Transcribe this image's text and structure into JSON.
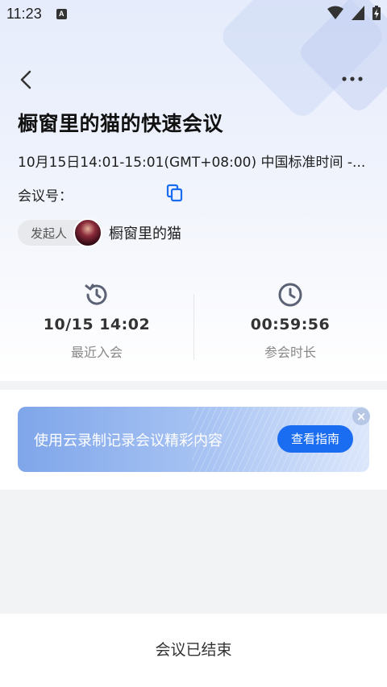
{
  "status_bar": {
    "time": "11:23",
    "notification_icon": "A"
  },
  "header": {
    "title": "橱窗里的猫的快速会议",
    "time_range": "10月15日14:01-15:01(GMT+08:00) 中国标准时间 -...",
    "meeting_id_label": "会议号：",
    "host_label": "发起人",
    "host_name": "橱窗里的猫"
  },
  "stats": [
    {
      "icon": "history-icon",
      "value": "10/15 14:02",
      "label": "最近入会"
    },
    {
      "icon": "clock-icon",
      "value": "00:59:56",
      "label": "参会时长"
    }
  ],
  "banner": {
    "text": "使用云录制记录会议精彩内容",
    "button_label": "查看指南",
    "close_glyph": "×"
  },
  "footer": {
    "status_text": "会议已结束"
  },
  "colors": {
    "accent": "#1a6cf0",
    "banner_start": "#7fa6ea",
    "background": "#f2f3f5"
  }
}
